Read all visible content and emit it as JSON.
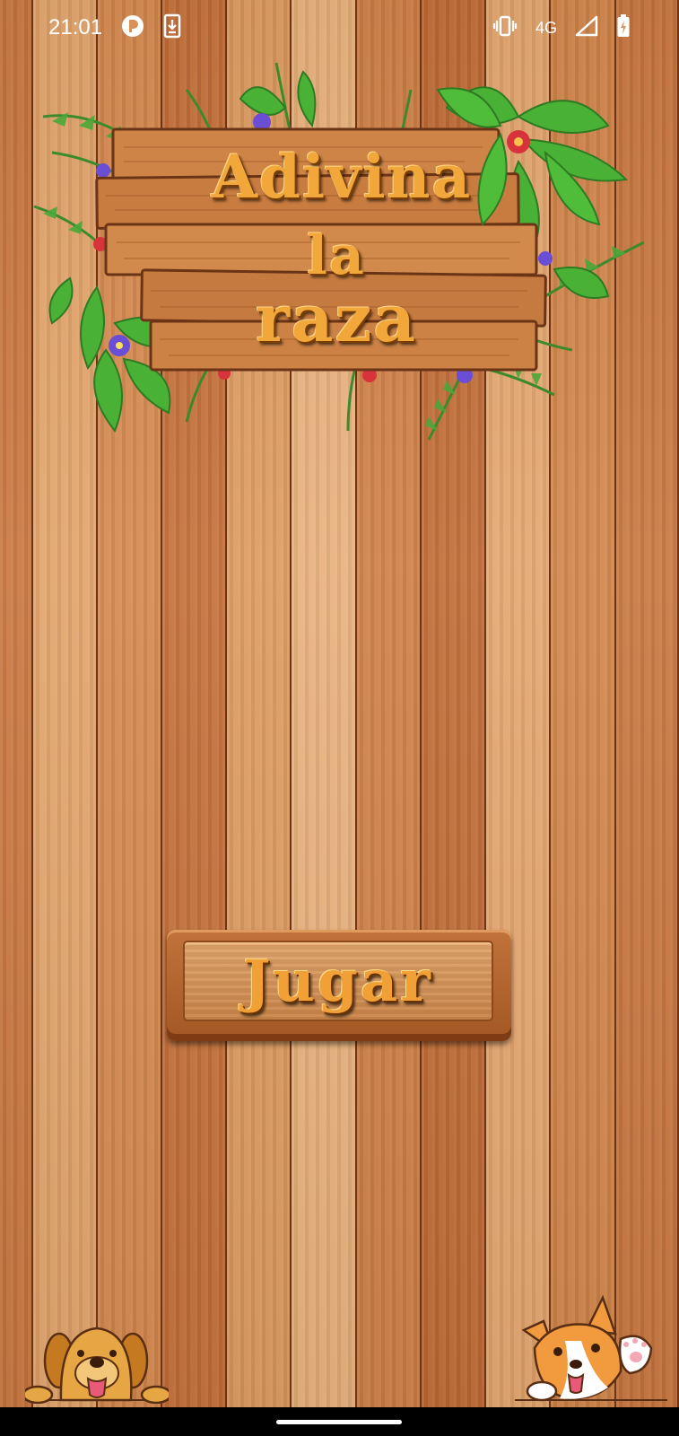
{
  "status_bar": {
    "time": "21:01",
    "network": "4G",
    "left_icons": [
      "app-notification-icon",
      "download-icon"
    ],
    "right_icons": [
      "vibrate-icon",
      "signal-icon",
      "battery-charging-icon"
    ]
  },
  "title": {
    "line1": "Adivina",
    "line2": "la",
    "line3": "raza"
  },
  "play_button": {
    "label": "Jugar"
  },
  "decorations": {
    "left_dog": "golden-retriever-peeking-icon",
    "right_dog": "corgi-waving-icon"
  },
  "colors": {
    "wood_planks": [
      "#c8763f",
      "#e2a36a",
      "#d5884d",
      "#c46f39",
      "#dd9a5f",
      "#e8b07a",
      "#cf7f45",
      "#c06b35",
      "#e4a56d",
      "#d18449"
    ],
    "plank_gap": "#6b3416",
    "title_text": "#f2a73b",
    "button_text": "#f0a035",
    "leaf_green": "#3f9a2a",
    "flower_purple": "#6a4fd6",
    "flower_red": "#d8333a"
  }
}
